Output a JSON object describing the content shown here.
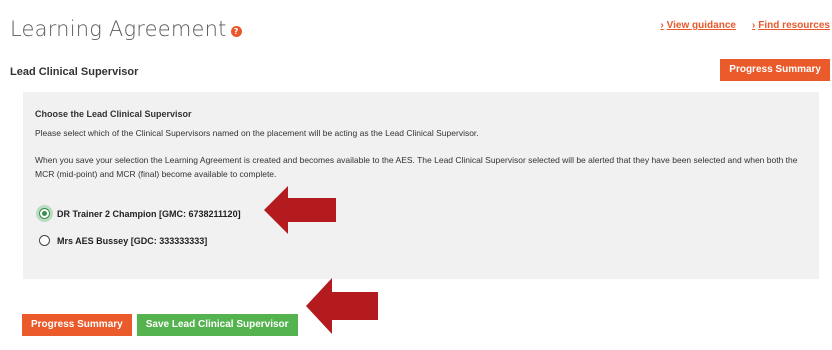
{
  "header": {
    "title": "Learning Agreement",
    "help_icon": "?",
    "links": [
      {
        "caret": "›",
        "label": "View guidance"
      },
      {
        "caret": "›",
        "label": "Find resources"
      }
    ]
  },
  "section": {
    "heading": "Lead Clinical Supervisor",
    "progress_button": "Progress Summary"
  },
  "panel": {
    "title": "Choose the Lead Clinical Supervisor",
    "text1": "Please select which of the Clinical Supervisors named on the placement will be acting as the Lead Clinical Supervisor.",
    "text2": "When you save your selection the Learning Agreement is created and becomes available to the AES. The Lead Clinical Supervisor selected will be alerted that they have been selected and when both the MCR (mid-point) and MCR (final) become available to complete.",
    "options": [
      {
        "label": "DR Trainer 2 Champion [GMC: 6738211120]",
        "selected": true
      },
      {
        "label": "Mrs AES Bussey [GDC: 333333333]",
        "selected": false
      }
    ]
  },
  "footer": {
    "progress_button": "Progress Summary",
    "save_button": "Save Lead Clinical Supervisor"
  },
  "colors": {
    "accent": "#ea5a2b",
    "save": "#55b34f",
    "arrow": "#b31b1f",
    "panel_bg": "#f1f1f1"
  }
}
